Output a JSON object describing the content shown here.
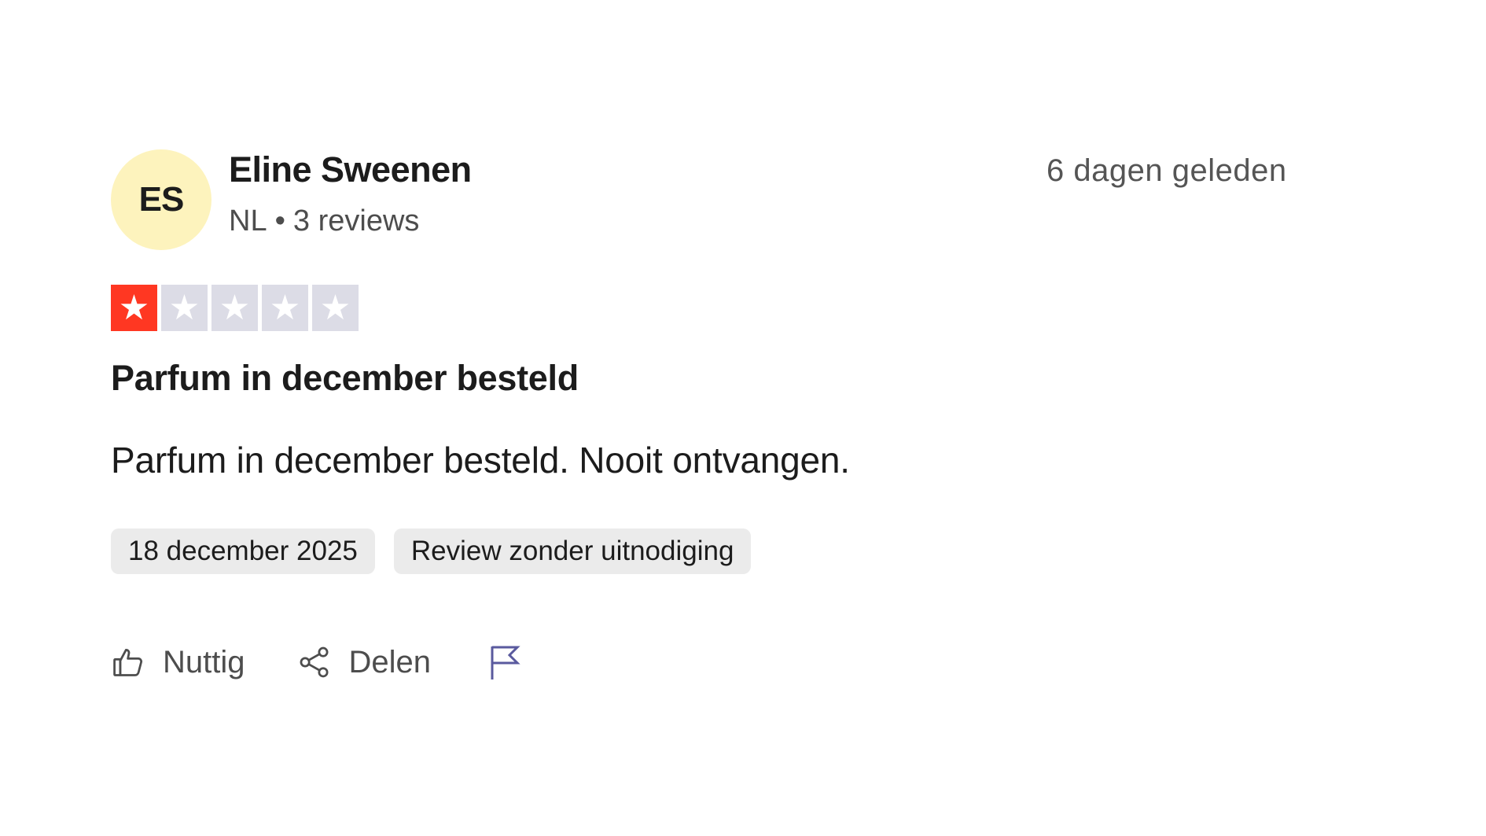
{
  "review": {
    "user": {
      "initials": "ES",
      "name": "Eline Sweenen",
      "country": "NL",
      "separator": "•",
      "review_count": "3 reviews",
      "avatar_color": "#fdf3bd"
    },
    "posted": "6 dagen geleden",
    "rating": {
      "value": 1,
      "max": 5,
      "filled_color": "#ff3722",
      "empty_color": "#dcdce6",
      "star_glyph": "★"
    },
    "title": "Parfum in december besteld",
    "body": "Parfum in december besteld. Nooit ontvangen.",
    "tags": {
      "date": "18 december 2025",
      "source": "Review zonder uitnodiging"
    },
    "actions": {
      "helpful_label": "Nuttig",
      "share_label": "Delen",
      "helpful_icon": "thumbs-up-icon",
      "share_icon": "share-icon",
      "report_icon": "flag-icon"
    }
  }
}
